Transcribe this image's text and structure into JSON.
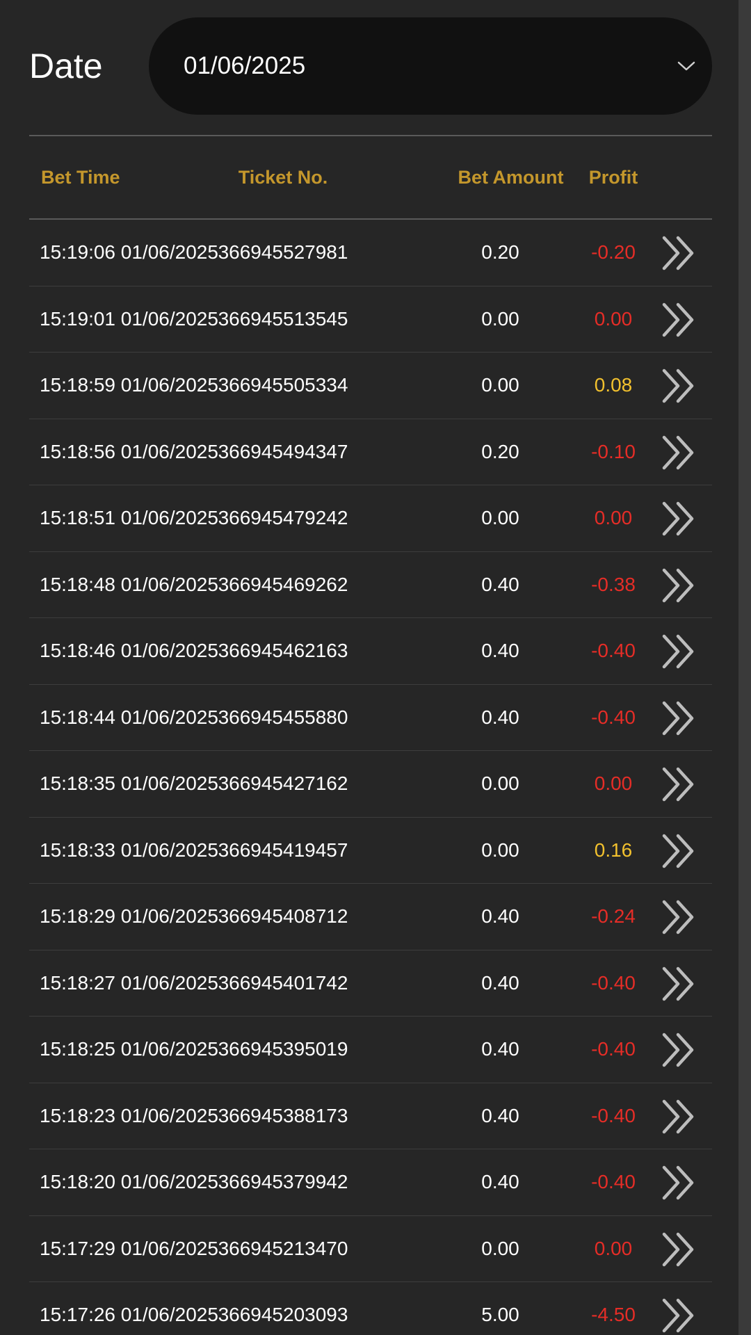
{
  "filter": {
    "label": "Date",
    "selected_date": "01/06/2025",
    "dropdown_icon": "chevron-down-icon"
  },
  "table": {
    "headers": {
      "bet_time": "Bet Time",
      "ticket_no": "Ticket No.",
      "bet_amount": "Bet Amount",
      "profit": "Profit"
    },
    "detail_icon": "double-chevron-right-icon",
    "rows": [
      {
        "bet_time": "15:19:06 01/06/2025",
        "ticket_no": "366945527981",
        "bet_amount": "0.20",
        "profit": "-0.20",
        "profit_color": "#e52d27"
      },
      {
        "bet_time": "15:19:01 01/06/2025",
        "ticket_no": "366945513545",
        "bet_amount": "0.00",
        "profit": "0.00",
        "profit_color": "#e52d27"
      },
      {
        "bet_time": "15:18:59 01/06/2025",
        "ticket_no": "366945505334",
        "bet_amount": "0.00",
        "profit": "0.08",
        "profit_color": "#f2c12e"
      },
      {
        "bet_time": "15:18:56 01/06/2025",
        "ticket_no": "366945494347",
        "bet_amount": "0.20",
        "profit": "-0.10",
        "profit_color": "#e52d27"
      },
      {
        "bet_time": "15:18:51 01/06/2025",
        "ticket_no": "366945479242",
        "bet_amount": "0.00",
        "profit": "0.00",
        "profit_color": "#e52d27"
      },
      {
        "bet_time": "15:18:48 01/06/2025",
        "ticket_no": "366945469262",
        "bet_amount": "0.40",
        "profit": "-0.38",
        "profit_color": "#e52d27"
      },
      {
        "bet_time": "15:18:46 01/06/2025",
        "ticket_no": "366945462163",
        "bet_amount": "0.40",
        "profit": "-0.40",
        "profit_color": "#e52d27"
      },
      {
        "bet_time": "15:18:44 01/06/2025",
        "ticket_no": "366945455880",
        "bet_amount": "0.40",
        "profit": "-0.40",
        "profit_color": "#e52d27"
      },
      {
        "bet_time": "15:18:35 01/06/2025",
        "ticket_no": "366945427162",
        "bet_amount": "0.00",
        "profit": "0.00",
        "profit_color": "#e52d27"
      },
      {
        "bet_time": "15:18:33 01/06/2025",
        "ticket_no": "366945419457",
        "bet_amount": "0.00",
        "profit": "0.16",
        "profit_color": "#f2c12e"
      },
      {
        "bet_time": "15:18:29 01/06/2025",
        "ticket_no": "366945408712",
        "bet_amount": "0.40",
        "profit": "-0.24",
        "profit_color": "#e52d27"
      },
      {
        "bet_time": "15:18:27 01/06/2025",
        "ticket_no": "366945401742",
        "bet_amount": "0.40",
        "profit": "-0.40",
        "profit_color": "#e52d27"
      },
      {
        "bet_time": "15:18:25 01/06/2025",
        "ticket_no": "366945395019",
        "bet_amount": "0.40",
        "profit": "-0.40",
        "profit_color": "#e52d27"
      },
      {
        "bet_time": "15:18:23 01/06/2025",
        "ticket_no": "366945388173",
        "bet_amount": "0.40",
        "profit": "-0.40",
        "profit_color": "#e52d27"
      },
      {
        "bet_time": "15:18:20 01/06/2025",
        "ticket_no": "366945379942",
        "bet_amount": "0.40",
        "profit": "-0.40",
        "profit_color": "#e52d27"
      },
      {
        "bet_time": "15:17:29 01/06/2025",
        "ticket_no": "366945213470",
        "bet_amount": "0.00",
        "profit": "0.00",
        "profit_color": "#e52d27"
      },
      {
        "bet_time": "15:17:26 01/06/2025",
        "ticket_no": "366945203093",
        "bet_amount": "5.00",
        "profit": "-4.50",
        "profit_color": "#e52d27"
      }
    ]
  },
  "colors": {
    "background": "#262626",
    "header_gold": "#c4972c",
    "loss_red": "#e52d27",
    "win_yellow": "#f2c12e",
    "select_bg": "#111111"
  }
}
